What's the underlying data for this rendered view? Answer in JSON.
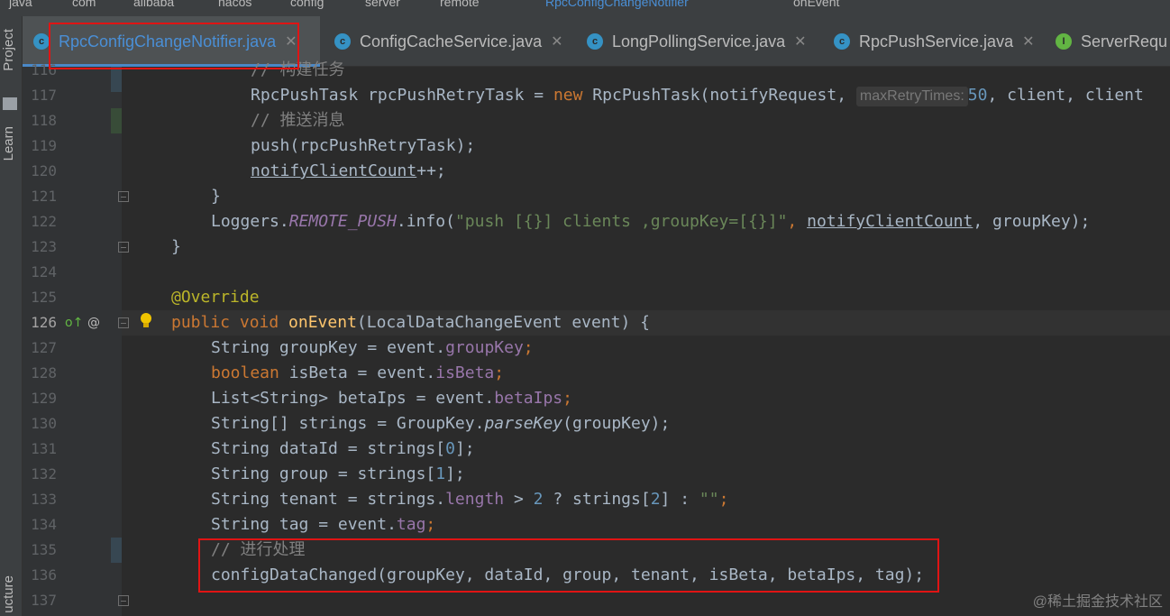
{
  "topbar": {
    "crumbs": [
      "java",
      "com",
      "alibaba",
      "nacos",
      "config",
      "server",
      "remote",
      "RpcConfigChangeNotifier",
      "onEvent"
    ]
  },
  "tabs": [
    {
      "name": "RpcConfigChangeNotifier.java",
      "kind": "class",
      "active": true
    },
    {
      "name": "ConfigCacheService.java",
      "kind": "class",
      "active": false
    },
    {
      "name": "LongPollingService.java",
      "kind": "class",
      "active": false
    },
    {
      "name": "RpcPushService.java",
      "kind": "class",
      "active": false
    },
    {
      "name": "ServerRequ",
      "kind": "interface",
      "active": false
    }
  ],
  "sidebar": {
    "project_label": "Project",
    "learn_label": "Learn",
    "structure_label": "ucture"
  },
  "editor": {
    "line_numbers": [
      "116",
      "117",
      "118",
      "119",
      "120",
      "121",
      "122",
      "123",
      "124",
      "125",
      "126",
      "127",
      "128",
      "129",
      "130",
      "131",
      "132",
      "133",
      "134",
      "135",
      "136",
      "137"
    ],
    "current_line": "126",
    "lines": {
      "l116": "// 构建任务",
      "l117_a": "RpcPushTask rpcPushRetryTask = ",
      "l117_new": "new",
      "l117_b": " RpcPushTask(notifyRequest, ",
      "l117_hint": "maxRetryTimes:",
      "l117_num": "50",
      "l117_c": ", client, client",
      "l118": "// 推送消息",
      "l119": "push(rpcPushRetryTask);",
      "l120_a": "notifyClientCount",
      "l120_b": "++;",
      "l121": "}",
      "l122_a": "Loggers.",
      "l122_b": "REMOTE_PUSH",
      "l122_c": ".info(",
      "l122_str": "\"push [{}] clients ,groupKey=[{}]\"",
      "l122_d": ", ",
      "l122_e": "notifyClientCount",
      "l122_f": ", groupKey);",
      "l123": "}",
      "l125": "@Override",
      "l126_kw": "public void ",
      "l126_fn": "onEvent",
      "l126_b": "(LocalDataChangeEvent event) {",
      "l127_a": "String groupKey = event.",
      "l127_f": "groupKey",
      "l127_e": ";",
      "l128_kw": "boolean",
      "l128_a": " isBeta = event.",
      "l128_f": "isBeta",
      "l128_e": ";",
      "l129_a": "List<String> betaIps = event.",
      "l129_f": "betaIps",
      "l129_e": ";",
      "l130_a": "String[] strings = GroupKey.",
      "l130_f": "parseKey",
      "l130_e": "(groupKey);",
      "l131_a": "String dataId = strings[",
      "l131_n": "0",
      "l131_e": "];",
      "l132_a": "String group = strings[",
      "l132_n": "1",
      "l132_e": "];",
      "l133_a": "String tenant = strings.",
      "l133_f": "length",
      "l133_b": " > ",
      "l133_n": "2",
      "l133_c": " ? strings[",
      "l133_n2": "2",
      "l133_d": "] : ",
      "l133_s": "\"\"",
      "l133_e": ";",
      "l134_a": "String tag = event.",
      "l134_f": "tag",
      "l134_e": ";",
      "l135": "// 进行处理",
      "l136_a": "configDataChanged(groupKey, dataId, group, tenant, isBeta, betaIps, tag);"
    }
  },
  "watermark": "@稀土掘金技术社区",
  "colors": {
    "background": "#2b2b2b",
    "keyword": "#cc7832",
    "string": "#6a8759",
    "field": "#9876aa",
    "highlight_box": "#e01414"
  }
}
